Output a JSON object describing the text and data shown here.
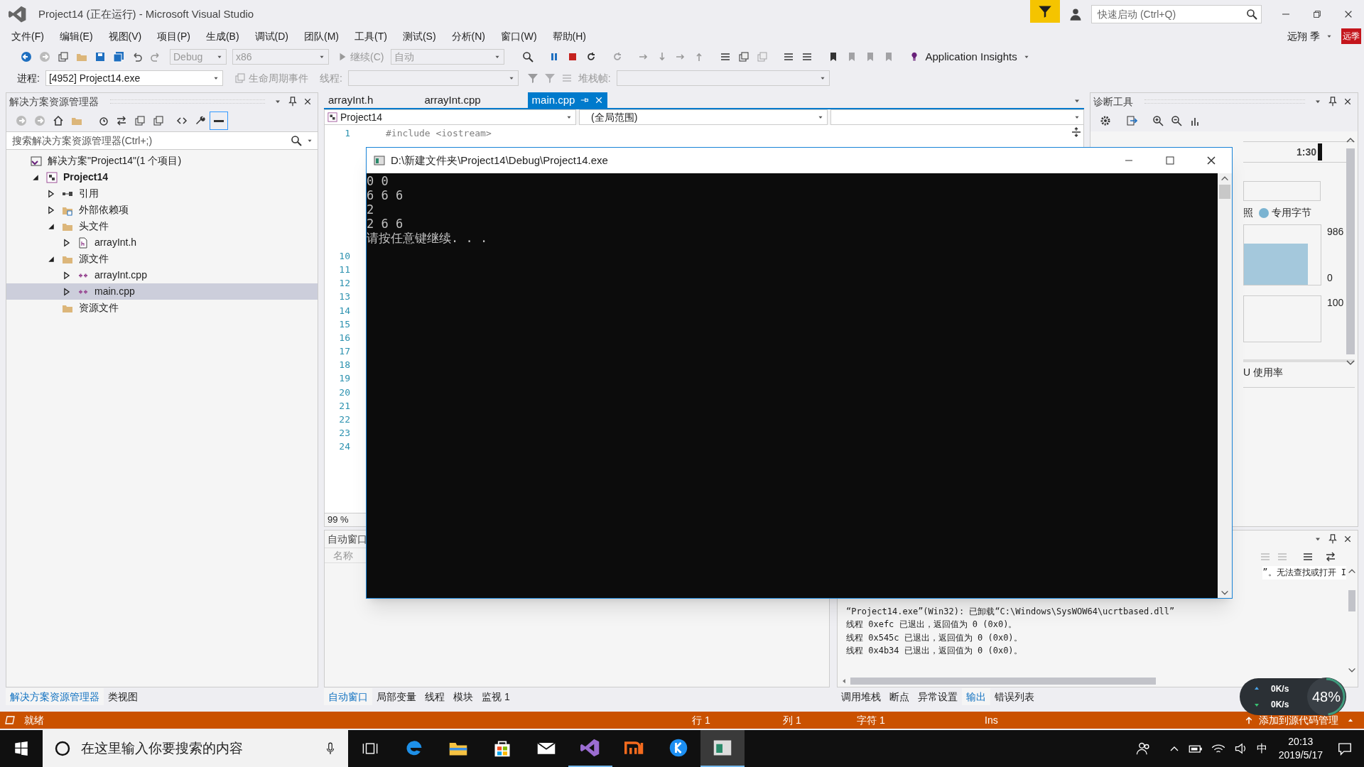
{
  "window": {
    "title": "Project14 (正在运行) - Microsoft Visual Studio"
  },
  "quick_launch": {
    "placeholder": "快速启动 (Ctrl+Q)"
  },
  "menu": [
    "文件(F)",
    "编辑(E)",
    "视图(V)",
    "项目(P)",
    "生成(B)",
    "调试(D)",
    "团队(M)",
    "工具(T)",
    "测试(S)",
    "分析(N)",
    "窗口(W)",
    "帮助(H)"
  ],
  "user": {
    "name": "远翔 季",
    "avatar": "远季"
  },
  "toolbar": {
    "config": "Debug",
    "platform": "x86",
    "continue": "继续(C)",
    "mode": "自动",
    "insights": "Application Insights"
  },
  "debug_toolbar": {
    "process_label": "进程:",
    "process": "[4952] Project14.exe",
    "lifecycle": "生命周期事件",
    "thread_label": "线程:",
    "stack_label": "堆栈帧:"
  },
  "solution_explorer": {
    "title": "解决方案资源管理器",
    "search": {
      "placeholder": "搜索解决方案资源管理器(Ctrl+;)"
    },
    "tree": [
      {
        "label": "解决方案\"Project14\"(1 个项目)",
        "kind": "solution",
        "selected": false,
        "children": [
          {
            "label": "Project14",
            "kind": "project",
            "expanded": true,
            "selected": false,
            "children": [
              {
                "label": "引用",
                "kind": "references",
                "expanded": false,
                "selected": false
              },
              {
                "label": "外部依赖项",
                "kind": "external",
                "expanded": false,
                "selected": false
              },
              {
                "label": "头文件",
                "kind": "folder",
                "expanded": true,
                "selected": false,
                "children": [
                  {
                    "label": "arrayInt.h",
                    "kind": "header",
                    "expanded": false,
                    "selected": false
                  }
                ]
              },
              {
                "label": "源文件",
                "kind": "folder",
                "expanded": true,
                "selected": false,
                "children": [
                  {
                    "label": "arrayInt.cpp",
                    "kind": "source",
                    "expanded": false,
                    "selected": false
                  },
                  {
                    "label": "main.cpp",
                    "kind": "source",
                    "expanded": false,
                    "selected": true
                  }
                ]
              },
              {
                "label": "资源文件",
                "kind": "folder",
                "selected": false
              }
            ]
          }
        ]
      }
    ],
    "tabs": [
      {
        "label": "解决方案资源管理器",
        "selected": true
      },
      {
        "label": "类视图",
        "selected": false
      }
    ]
  },
  "editor": {
    "tabs": [
      {
        "label": "arrayInt.h",
        "selected": false
      },
      {
        "label": "arrayInt.cpp",
        "selected": false
      },
      {
        "label": "main.cpp",
        "selected": true
      }
    ],
    "project": "Project14",
    "scope": "(全局范围)",
    "lines": [
      {
        "number": "1",
        "code": "#include <iostream>"
      },
      {
        "number": "10"
      },
      {
        "number": "11"
      },
      {
        "number": "12"
      },
      {
        "number": "13"
      },
      {
        "number": "14"
      },
      {
        "number": "15"
      },
      {
        "number": "16"
      },
      {
        "number": "17"
      },
      {
        "number": "18"
      },
      {
        "number": "19"
      },
      {
        "number": "20"
      },
      {
        "number": "21"
      },
      {
        "number": "22"
      },
      {
        "number": "23"
      },
      {
        "number": "24"
      }
    ],
    "zoom": "99 %"
  },
  "console": {
    "title": "D:\\新建文件夹\\Project14\\Debug\\Project14.exe",
    "lines": [
      "0 0",
      "6 6 6",
      "2",
      "2 6 6",
      "请按任意键继续. . ."
    ]
  },
  "diagnostics": {
    "title": "诊断工具",
    "time": "1:30",
    "legend": [
      {
        "label": "照"
      },
      {
        "label": "专用字节",
        "color": "#7ab3d1"
      }
    ],
    "axis": [
      "986",
      "0",
      "100"
    ],
    "cpu": "U 使用率"
  },
  "autos": {
    "title": "自动窗口",
    "column": "名称",
    "tabs": [
      {
        "label": "自动窗口",
        "selected": true
      },
      {
        "label": "局部变量",
        "selected": false
      },
      {
        "label": "线程",
        "selected": false
      },
      {
        "label": "模块",
        "selected": false
      },
      {
        "label": "监视 1",
        "selected": false
      }
    ]
  },
  "output": {
    "partial": "”。无法查找或打开 I",
    "lines": [
      "“Project14.exe”(Win32): 已卸载“C:\\Windows\\SysWOW64\\ucrtbased.dll”",
      "线程 0xefc 已退出，返回值为 0 (0x0)。",
      "线程 0x545c 已退出，返回值为 0 (0x0)。",
      "线程 0x4b34 已退出，返回值为 0 (0x0)。"
    ],
    "tabs": [
      {
        "label": "调用堆栈",
        "selected": false
      },
      {
        "label": "断点",
        "selected": false
      },
      {
        "label": "异常设置",
        "selected": false
      },
      {
        "label": "输出",
        "selected": true
      },
      {
        "label": "错误列表",
        "selected": false
      }
    ]
  },
  "status_bar": {
    "state": "就绪",
    "line": "行 1",
    "column": "列 1",
    "char": "字符 1",
    "mode": "Ins",
    "source_control": "添加到源代码管理"
  },
  "network": {
    "up": "0K/s",
    "down": "0K/s",
    "percent": "48%",
    "level": 0.48
  },
  "taskbar": {
    "search": {
      "placeholder": "在这里输入你要搜索的内容"
    },
    "apps": [
      {
        "kind": "edge",
        "running": false,
        "selected": false
      },
      {
        "kind": "explorer",
        "running": false,
        "selected": false
      },
      {
        "kind": "store",
        "running": false,
        "selected": false
      },
      {
        "kind": "mail",
        "running": false,
        "selected": false
      },
      {
        "kind": "vs",
        "running": true,
        "selected": false
      },
      {
        "kind": "mi",
        "running": false,
        "selected": false
      },
      {
        "kind": "k",
        "running": false,
        "selected": false
      },
      {
        "kind": "console",
        "running": true,
        "selected": true
      }
    ],
    "ime": "中",
    "time": "20:13",
    "date": "2019/5/17"
  }
}
